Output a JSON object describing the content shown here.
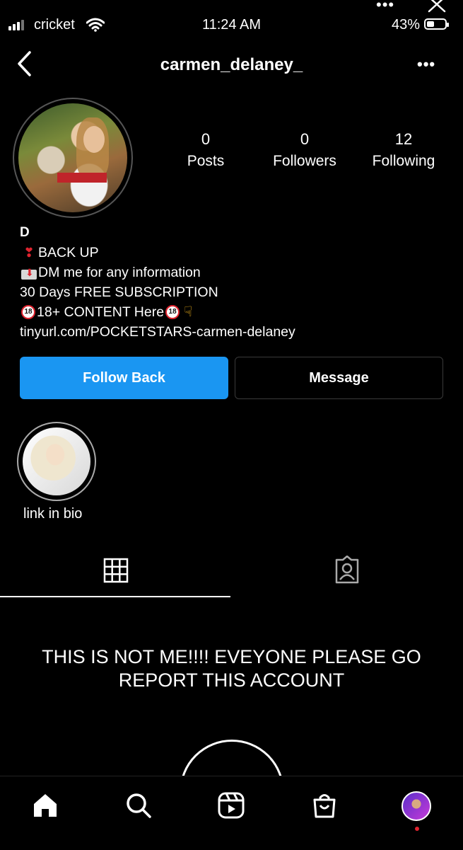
{
  "status_bar": {
    "carrier": "cricket",
    "time": "11:24 AM",
    "battery": "43%",
    "battery_level": 0.43,
    "icons": [
      "signal-bars-icon",
      "wifi-icon",
      "battery-icon",
      "more-dots-icon",
      "close-icon"
    ]
  },
  "header": {
    "username": "carmen_delaney_",
    "more_label": "•••",
    "back_icon": "chevron-left-icon"
  },
  "profile": {
    "stats": [
      {
        "count": "0",
        "label": "Posts"
      },
      {
        "count": "0",
        "label": "Followers"
      },
      {
        "count": "12",
        "label": "Following"
      }
    ],
    "bio": {
      "name": "D",
      "line1": "BACK UP",
      "line2": "DM me for any information",
      "line3": "30 Days FREE SUBSCRIPTION",
      "line4": "18+ CONTENT Here",
      "badge": "18",
      "link": "tinyurl.com/POCKETSTARS-carmen-delaney"
    }
  },
  "actions": {
    "follow_back": "Follow Back",
    "message": "Message"
  },
  "highlight": {
    "label": "link in bio"
  },
  "tabs": [
    "grid-icon",
    "tagged-icon"
  ],
  "caption": {
    "line1": "THIS IS NOT ME!!!! EVEYONE PLEASE GO",
    "line2": "REPORT THIS ACCOUNT"
  },
  "bottom_nav": [
    "home-icon",
    "search-icon",
    "reels-icon",
    "shop-icon",
    "profile-avatar"
  ],
  "colors": {
    "accent": "#1a96f2",
    "background": "#000000",
    "notification_dot": "#e0242f"
  }
}
